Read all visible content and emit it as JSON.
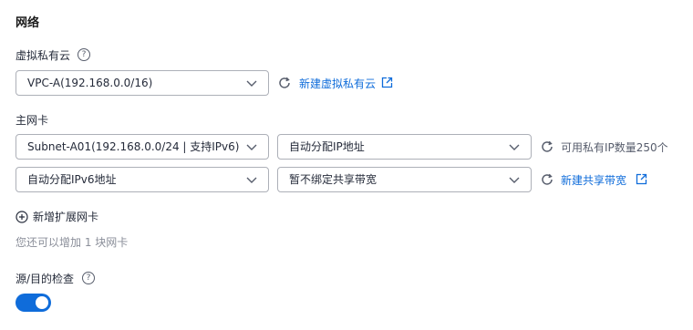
{
  "network": {
    "title": "网络",
    "vpc": {
      "label": "虚拟私有云",
      "help_icon": "?",
      "selected": "VPC-A(192.168.0.0/16)",
      "create_link": "新建虚拟私有云"
    },
    "nic": {
      "label": "主网卡",
      "subnet_selected": "Subnet-A01(192.168.0.0/24 | 支持IPv6)",
      "ip_mode_selected": "自动分配IP地址",
      "available_ip_text": "可用私有IP数量250个",
      "ipv6_selected": "自动分配IPv6地址",
      "bandwidth_selected": "暂不绑定共享带宽",
      "create_bandwidth_link": "新建共享带宽"
    },
    "add_nic": {
      "label": "新增扩展网卡",
      "hint": "您还可以增加 1 块网卡"
    },
    "source_dest_check": {
      "label": "源/目的检查",
      "help_icon": "?",
      "enabled": true
    }
  },
  "colors": {
    "accent": "#0f6cda",
    "border": "#adb0b8",
    "text": "#252b3a",
    "muted": "#575d6c",
    "hint": "#8a8e99"
  },
  "icons": [
    "help-icon",
    "chevron-down-icon",
    "refresh-icon",
    "external-link-icon",
    "plus-circle-icon"
  ]
}
